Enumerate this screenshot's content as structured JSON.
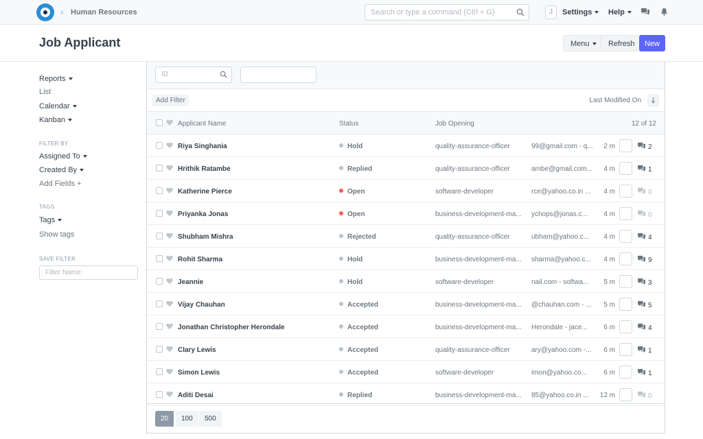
{
  "navbar": {
    "breadcrumb": "Human Resources",
    "search_placeholder": "Search or type a command (Ctrl + G)",
    "avatar_letter": "J",
    "settings": "Settings",
    "help": "Help"
  },
  "page": {
    "title": "Job Applicant",
    "menu": "Menu",
    "refresh": "Refresh",
    "new": "New"
  },
  "sidebar": {
    "reports": "Reports",
    "list": "List",
    "calendar": "Calendar",
    "kanban": "Kanban",
    "filter_by": "FILTER BY",
    "assigned_to": "Assigned To",
    "created_by": "Created By",
    "add_fields": "Add Fields",
    "tags_head": "TAGS",
    "tags": "Tags",
    "show_tags": "Show tags",
    "save_filter_head": "SAVE FILTER",
    "filter_name_placeholder": "Filter Name"
  },
  "list": {
    "id_placeholder": "ID",
    "add_filter": "Add Filter",
    "sort_label": "Last Modified On",
    "columns": {
      "name": "Applicant Name",
      "status": "Status",
      "job": "Job Opening",
      "count": "12 of 12"
    },
    "rows": [
      {
        "name": "Riya Singhania",
        "status": "Hold",
        "status_color": "#b8c2cc",
        "job": "quality-assurance-officer",
        "email": "99@gmail.com - q...",
        "time": "2 m",
        "comments": "2"
      },
      {
        "name": "Hrithik Ratambe",
        "status": "Replied",
        "status_color": "#b8c2cc",
        "job": "quality-assurance-officer",
        "email": "ambe@gmail.com...",
        "time": "4 m",
        "comments": "1"
      },
      {
        "name": "Katherine Pierce",
        "status": "Open",
        "status_color": "#ff5858",
        "job": "software-developer",
        "email": "rce@yahoo.co.in ...",
        "time": "4 m",
        "comments": "0"
      },
      {
        "name": "Priyanka Jonas",
        "status": "Open",
        "status_color": "#ff5858",
        "job": "business-development-ma...",
        "email": "ychops@jonas.c...",
        "time": "4 m",
        "comments": "0"
      },
      {
        "name": "Shubham Mishra",
        "status": "Rejected",
        "status_color": "#b8c2cc",
        "job": "quality-assurance-officer",
        "email": "ubham@yahoo.c...",
        "time": "4 m",
        "comments": "4"
      },
      {
        "name": "Rohit Sharma",
        "status": "Hold",
        "status_color": "#b8c2cc",
        "job": "business-development-ma...",
        "email": "sharma@yahoo.c...",
        "time": "4 m",
        "comments": "9"
      },
      {
        "name": "Jeannie",
        "status": "Hold",
        "status_color": "#b8c2cc",
        "job": "software-developer",
        "email": "nail.com - softwa...",
        "time": "5 m",
        "comments": "3"
      },
      {
        "name": "Vijay Chauhan",
        "status": "Accepted",
        "status_color": "#b8c2cc",
        "job": "business-development-ma...",
        "email": "@chauhan.com - ...",
        "time": "5 m",
        "comments": "5"
      },
      {
        "name": "Jonathan Christopher Herondale",
        "status": "Accepted",
        "status_color": "#b8c2cc",
        "job": "business-development-ma...",
        "email": "Herondale - jace...",
        "time": "6 m",
        "comments": "4"
      },
      {
        "name": "Clary Lewis",
        "status": "Accepted",
        "status_color": "#b8c2cc",
        "job": "quality-assurance-officer",
        "email": "ary@yahoo.com -...",
        "time": "6 m",
        "comments": "1"
      },
      {
        "name": "Simon Lewis",
        "status": "Accepted",
        "status_color": "#b8c2cc",
        "job": "software-developer",
        "email": "imon@yahoo.co...",
        "time": "6 m",
        "comments": "1"
      },
      {
        "name": "Aditi Desai",
        "status": "Replied",
        "status_color": "#b8c2cc",
        "job": "business-development-ma...",
        "email": "85@yahoo.co.in ...",
        "time": "12 m",
        "comments": "0"
      }
    ],
    "page_sizes": [
      "20",
      "100",
      "500"
    ]
  }
}
